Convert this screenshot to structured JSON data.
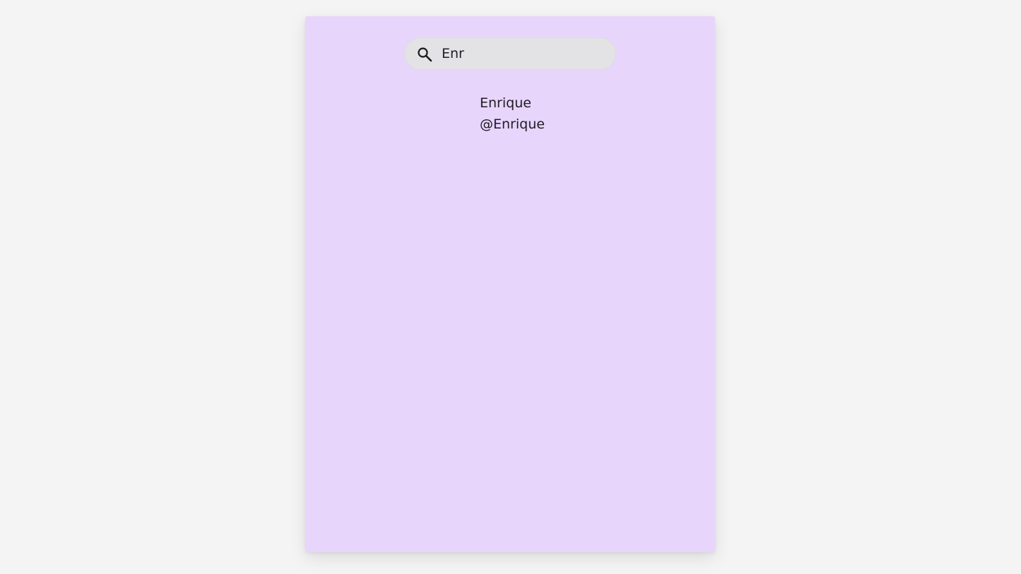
{
  "search": {
    "value": "Enr",
    "icon": "search-icon"
  },
  "results": [
    {
      "name": "Enrique",
      "handle": "@Enrique"
    }
  ],
  "colors": {
    "page_background": "#f4f4f4",
    "panel_background": "#e8d5fc",
    "search_background": "#e3e3e5",
    "text": "#1e1b22"
  }
}
